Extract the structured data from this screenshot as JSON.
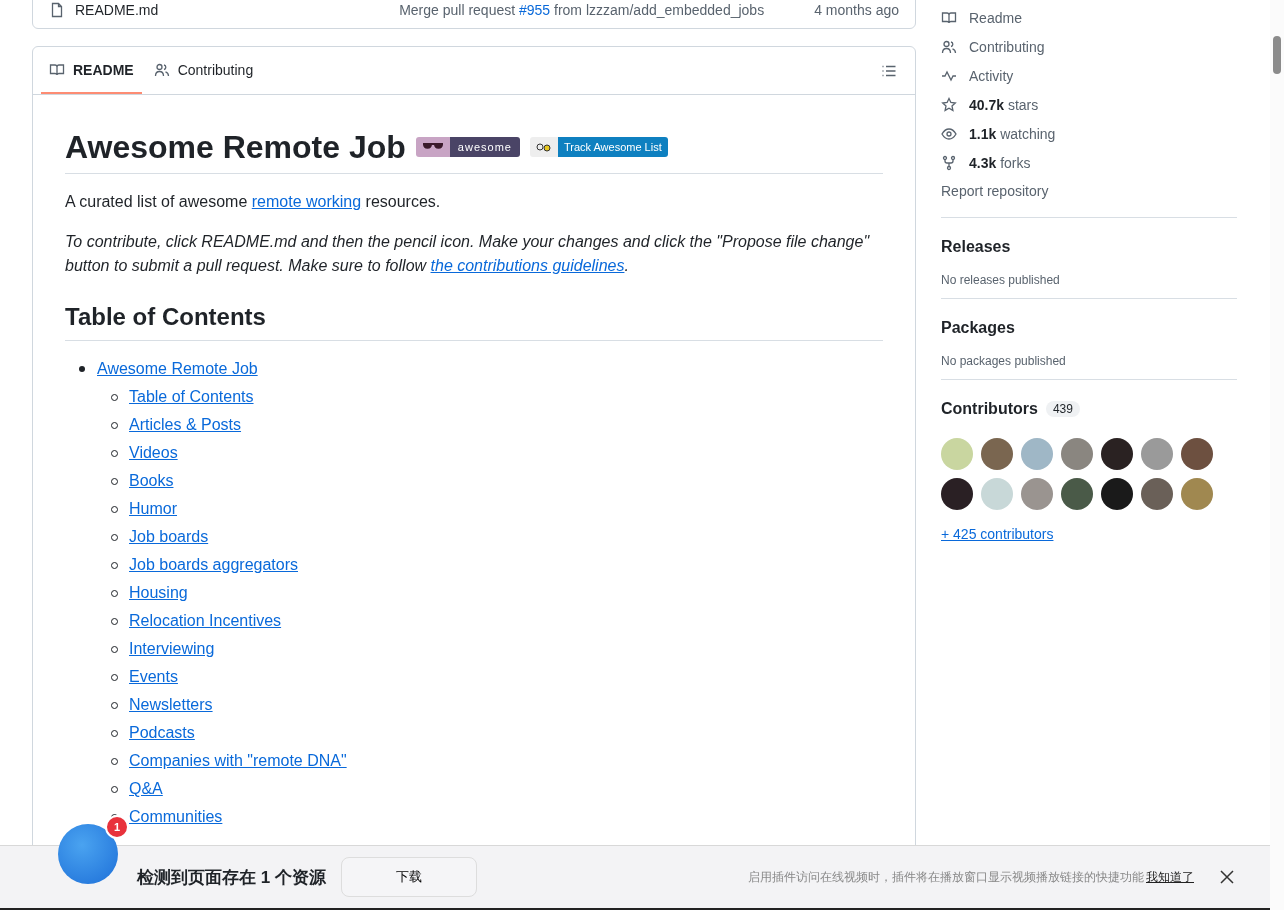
{
  "file_row": {
    "name": "README.md",
    "commit_before": "Merge pull request",
    "commit_link": "#955",
    "commit_after": "from lzzzam/add_embedded_jobs",
    "time": "4 months ago"
  },
  "tabs": [
    {
      "label": "README",
      "selected": true
    },
    {
      "label": "Contributing",
      "selected": false
    }
  ],
  "readme": {
    "title": "Awesome Remote Job",
    "badges": [
      {
        "kind": "awesome",
        "label": "awesome"
      },
      {
        "kind": "track",
        "label": "Track Awesome List"
      }
    ],
    "intro": {
      "before": "A curated list of awesome",
      "link": "remote working",
      "after": "resources."
    },
    "contribute": {
      "before": "To contribute, click README.md and then the pencil icon. Make your changes and click the \"Propose file change\" button to submit a pull request. Make sure to follow",
      "link": "the contributions guidelines",
      "after": "."
    },
    "toc_heading": "Table of Contents",
    "toc": [
      {
        "label": "Awesome Remote Job",
        "children": [
          {
            "label": "Table of Contents"
          },
          {
            "label": "Articles & Posts"
          },
          {
            "label": "Videos"
          },
          {
            "label": "Books"
          },
          {
            "label": "Humor"
          },
          {
            "label": "Job boards"
          },
          {
            "label": "Job boards aggregators"
          },
          {
            "label": "Housing"
          },
          {
            "label": "Relocation Incentives"
          },
          {
            "label": "Interviewing"
          },
          {
            "label": "Events"
          },
          {
            "label": "Newsletters"
          },
          {
            "label": "Podcasts"
          },
          {
            "label": "Companies with \"remote DNA\""
          },
          {
            "label": "Q&A"
          },
          {
            "label": "Communities"
          }
        ]
      }
    ]
  },
  "sidebar": {
    "links": [
      {
        "label": "Readme"
      },
      {
        "label": "Contributing"
      },
      {
        "label": "Activity"
      },
      {
        "count": "40.7k",
        "label": "stars"
      },
      {
        "count": "1.1k",
        "label": "watching"
      },
      {
        "count": "4.3k",
        "label": "forks"
      }
    ],
    "report": "Report repository",
    "releases": {
      "heading": "Releases",
      "text": "No releases published"
    },
    "packages": {
      "heading": "Packages",
      "text": "No packages published"
    },
    "contributors": {
      "heading": "Contributors",
      "count": "439",
      "more": "+ 425 contributors"
    }
  },
  "download_bar": {
    "badge": "1",
    "message": "检测到页面存在 1 个资源",
    "button": "下载",
    "notice": "启用插件访问在线视频时，插件将在播放窗口显示视频播放链接的快捷功能",
    "dismiss": "我知道了"
  }
}
